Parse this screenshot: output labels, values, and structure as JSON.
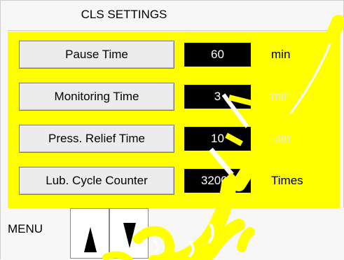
{
  "title": "CLS SETTINGS",
  "rows": [
    {
      "label": "Pause Time",
      "value": "60",
      "unit": "min"
    },
    {
      "label": "Monitoring Time",
      "value": "3",
      "unit": "min"
    },
    {
      "label": "Press. Relief Time",
      "value": "10",
      "unit": "min"
    },
    {
      "label": "Lub. Cycle Counter",
      "value": "32000",
      "unit": "Times"
    }
  ],
  "menu": {
    "label": "MENU",
    "up_icon": "arrow-up-icon",
    "down_icon": "arrow-down-icon"
  },
  "colors": {
    "panel": "#ffff00",
    "value_bg": "#000000",
    "value_text": "#ffffff"
  }
}
